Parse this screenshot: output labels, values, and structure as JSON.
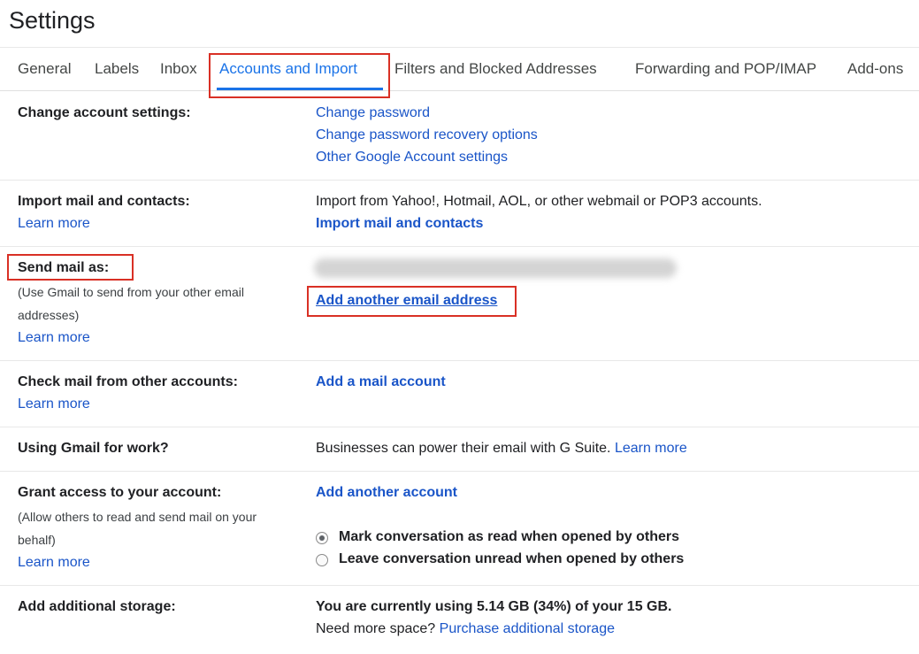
{
  "page": {
    "title": "Settings"
  },
  "tabs": [
    {
      "label": "General"
    },
    {
      "label": "Labels"
    },
    {
      "label": "Inbox"
    },
    {
      "label": "Accounts and Import"
    },
    {
      "label": "Filters and Blocked Addresses"
    },
    {
      "label": "Forwarding and POP/IMAP"
    },
    {
      "label": "Add-ons"
    }
  ],
  "sections": {
    "change_account": {
      "label": "Change account settings:",
      "links": [
        "Change password",
        "Change password recovery options",
        "Other Google Account settings"
      ]
    },
    "import": {
      "label": "Import mail and contacts:",
      "learn_more": "Learn more",
      "description": "Import from Yahoo!, Hotmail, AOL, or other webmail or POP3 accounts.",
      "action": "Import mail and contacts"
    },
    "send_as": {
      "label": "Send mail as:",
      "sub_line1": "(Use Gmail to send from your other email",
      "sub_line2": "addresses)",
      "learn_more": "Learn more",
      "action": "Add another email address"
    },
    "check_mail": {
      "label": "Check mail from other accounts:",
      "learn_more": "Learn more",
      "action": "Add a mail account"
    },
    "work": {
      "label": "Using Gmail for work?",
      "description": "Businesses can power their email with G Suite.",
      "learn_more": "Learn more"
    },
    "grant": {
      "label": "Grant access to your account:",
      "sub_line1": "(Allow others to read and send mail on your",
      "sub_line2": "behalf)",
      "learn_more": "Learn more",
      "action": "Add another account",
      "radio_options": [
        {
          "label": "Mark conversation as read when opened by others",
          "checked": true
        },
        {
          "label": "Leave conversation unread when opened by others",
          "checked": false
        }
      ]
    },
    "storage": {
      "label": "Add additional storage:",
      "usage": "You are currently using 5.14 GB (34%) of your 15 GB.",
      "need_more": "Need more space?",
      "action": "Purchase additional storage"
    }
  },
  "colors": {
    "accent": "#1a73e8",
    "link": "#1a55c8",
    "highlight_box": "#d93025"
  }
}
